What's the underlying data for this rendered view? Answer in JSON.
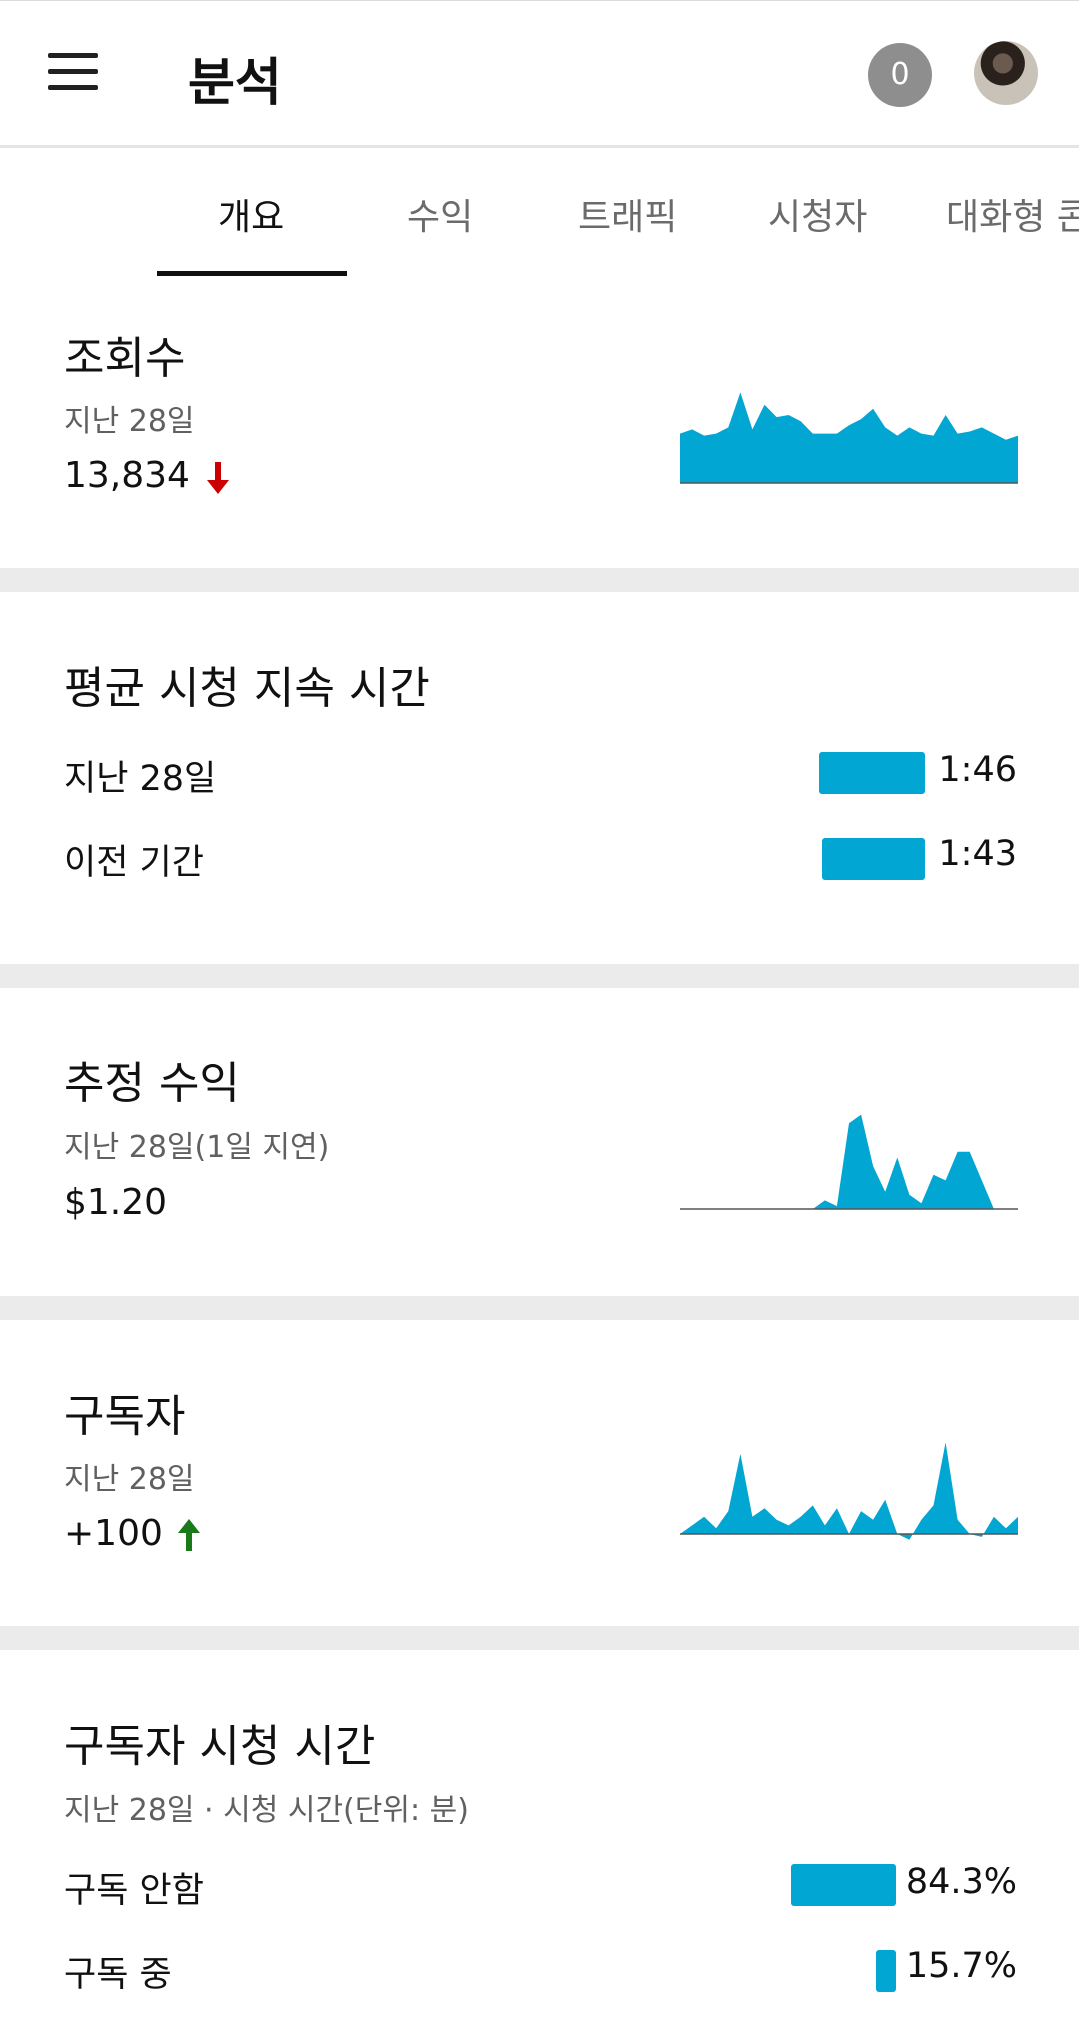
{
  "header": {
    "title": "분석",
    "notification_count": "0",
    "menu_icon": "hamburger-menu-icon",
    "avatar_icon": "user-avatar"
  },
  "tabs": [
    {
      "label": "개요",
      "active": true
    },
    {
      "label": "수익",
      "active": false
    },
    {
      "label": "트래픽",
      "active": false
    },
    {
      "label": "시청자",
      "active": false
    },
    {
      "label": "대화형 콘",
      "active": false
    }
  ],
  "colors": {
    "accent": "#02a6d2",
    "down": "#cc0000",
    "up": "#1a7a1a",
    "divider": "#ebebeb"
  },
  "views": {
    "title": "조회수",
    "period": "지난 28일",
    "value": "13,834",
    "trend": "down",
    "sparkline": [
      24,
      26,
      23,
      24,
      27,
      44,
      26,
      38,
      32,
      33,
      30,
      24,
      24,
      24,
      28,
      31,
      36,
      27,
      23,
      27,
      24,
      23,
      33,
      24,
      25,
      27,
      24,
      21,
      23
    ]
  },
  "avg_view_duration": {
    "title": "평균 시청 지속 시간",
    "rows": [
      {
        "label": "지난 28일",
        "value": "1:46",
        "fraction": 1.0
      },
      {
        "label": "이전 기간",
        "value": "1:43",
        "fraction": 0.97
      }
    ]
  },
  "estimated_revenue": {
    "title": "추정 수익",
    "period": "지난 28일(1일 지연)",
    "value": "$1.20",
    "sparkline": [
      0,
      0,
      0,
      0,
      0,
      0,
      0,
      0,
      0,
      0,
      0,
      0,
      3,
      1,
      30,
      33,
      15,
      6,
      18,
      5,
      2,
      12,
      10,
      20,
      20,
      10,
      0,
      0,
      0
    ]
  },
  "subscribers": {
    "title": "구독자",
    "period": "지난 28일",
    "value": "+100",
    "trend": "up",
    "sparkline": [
      0,
      3,
      6,
      2,
      8,
      28,
      6,
      9,
      5,
      3,
      6,
      10,
      3,
      9,
      0,
      8,
      5,
      12,
      0,
      -2,
      5,
      10,
      32,
      5,
      0,
      -1,
      6,
      2,
      6
    ]
  },
  "subscriber_watch_time": {
    "title": "구독자 시청 시간",
    "period": "지난 28일 · 시청 시간(단위: 분)",
    "rows": [
      {
        "label": "구독 안함",
        "value": "84.3%",
        "fraction": 0.843
      },
      {
        "label": "구독 중",
        "value": "15.7%",
        "fraction": 0.157
      }
    ]
  }
}
